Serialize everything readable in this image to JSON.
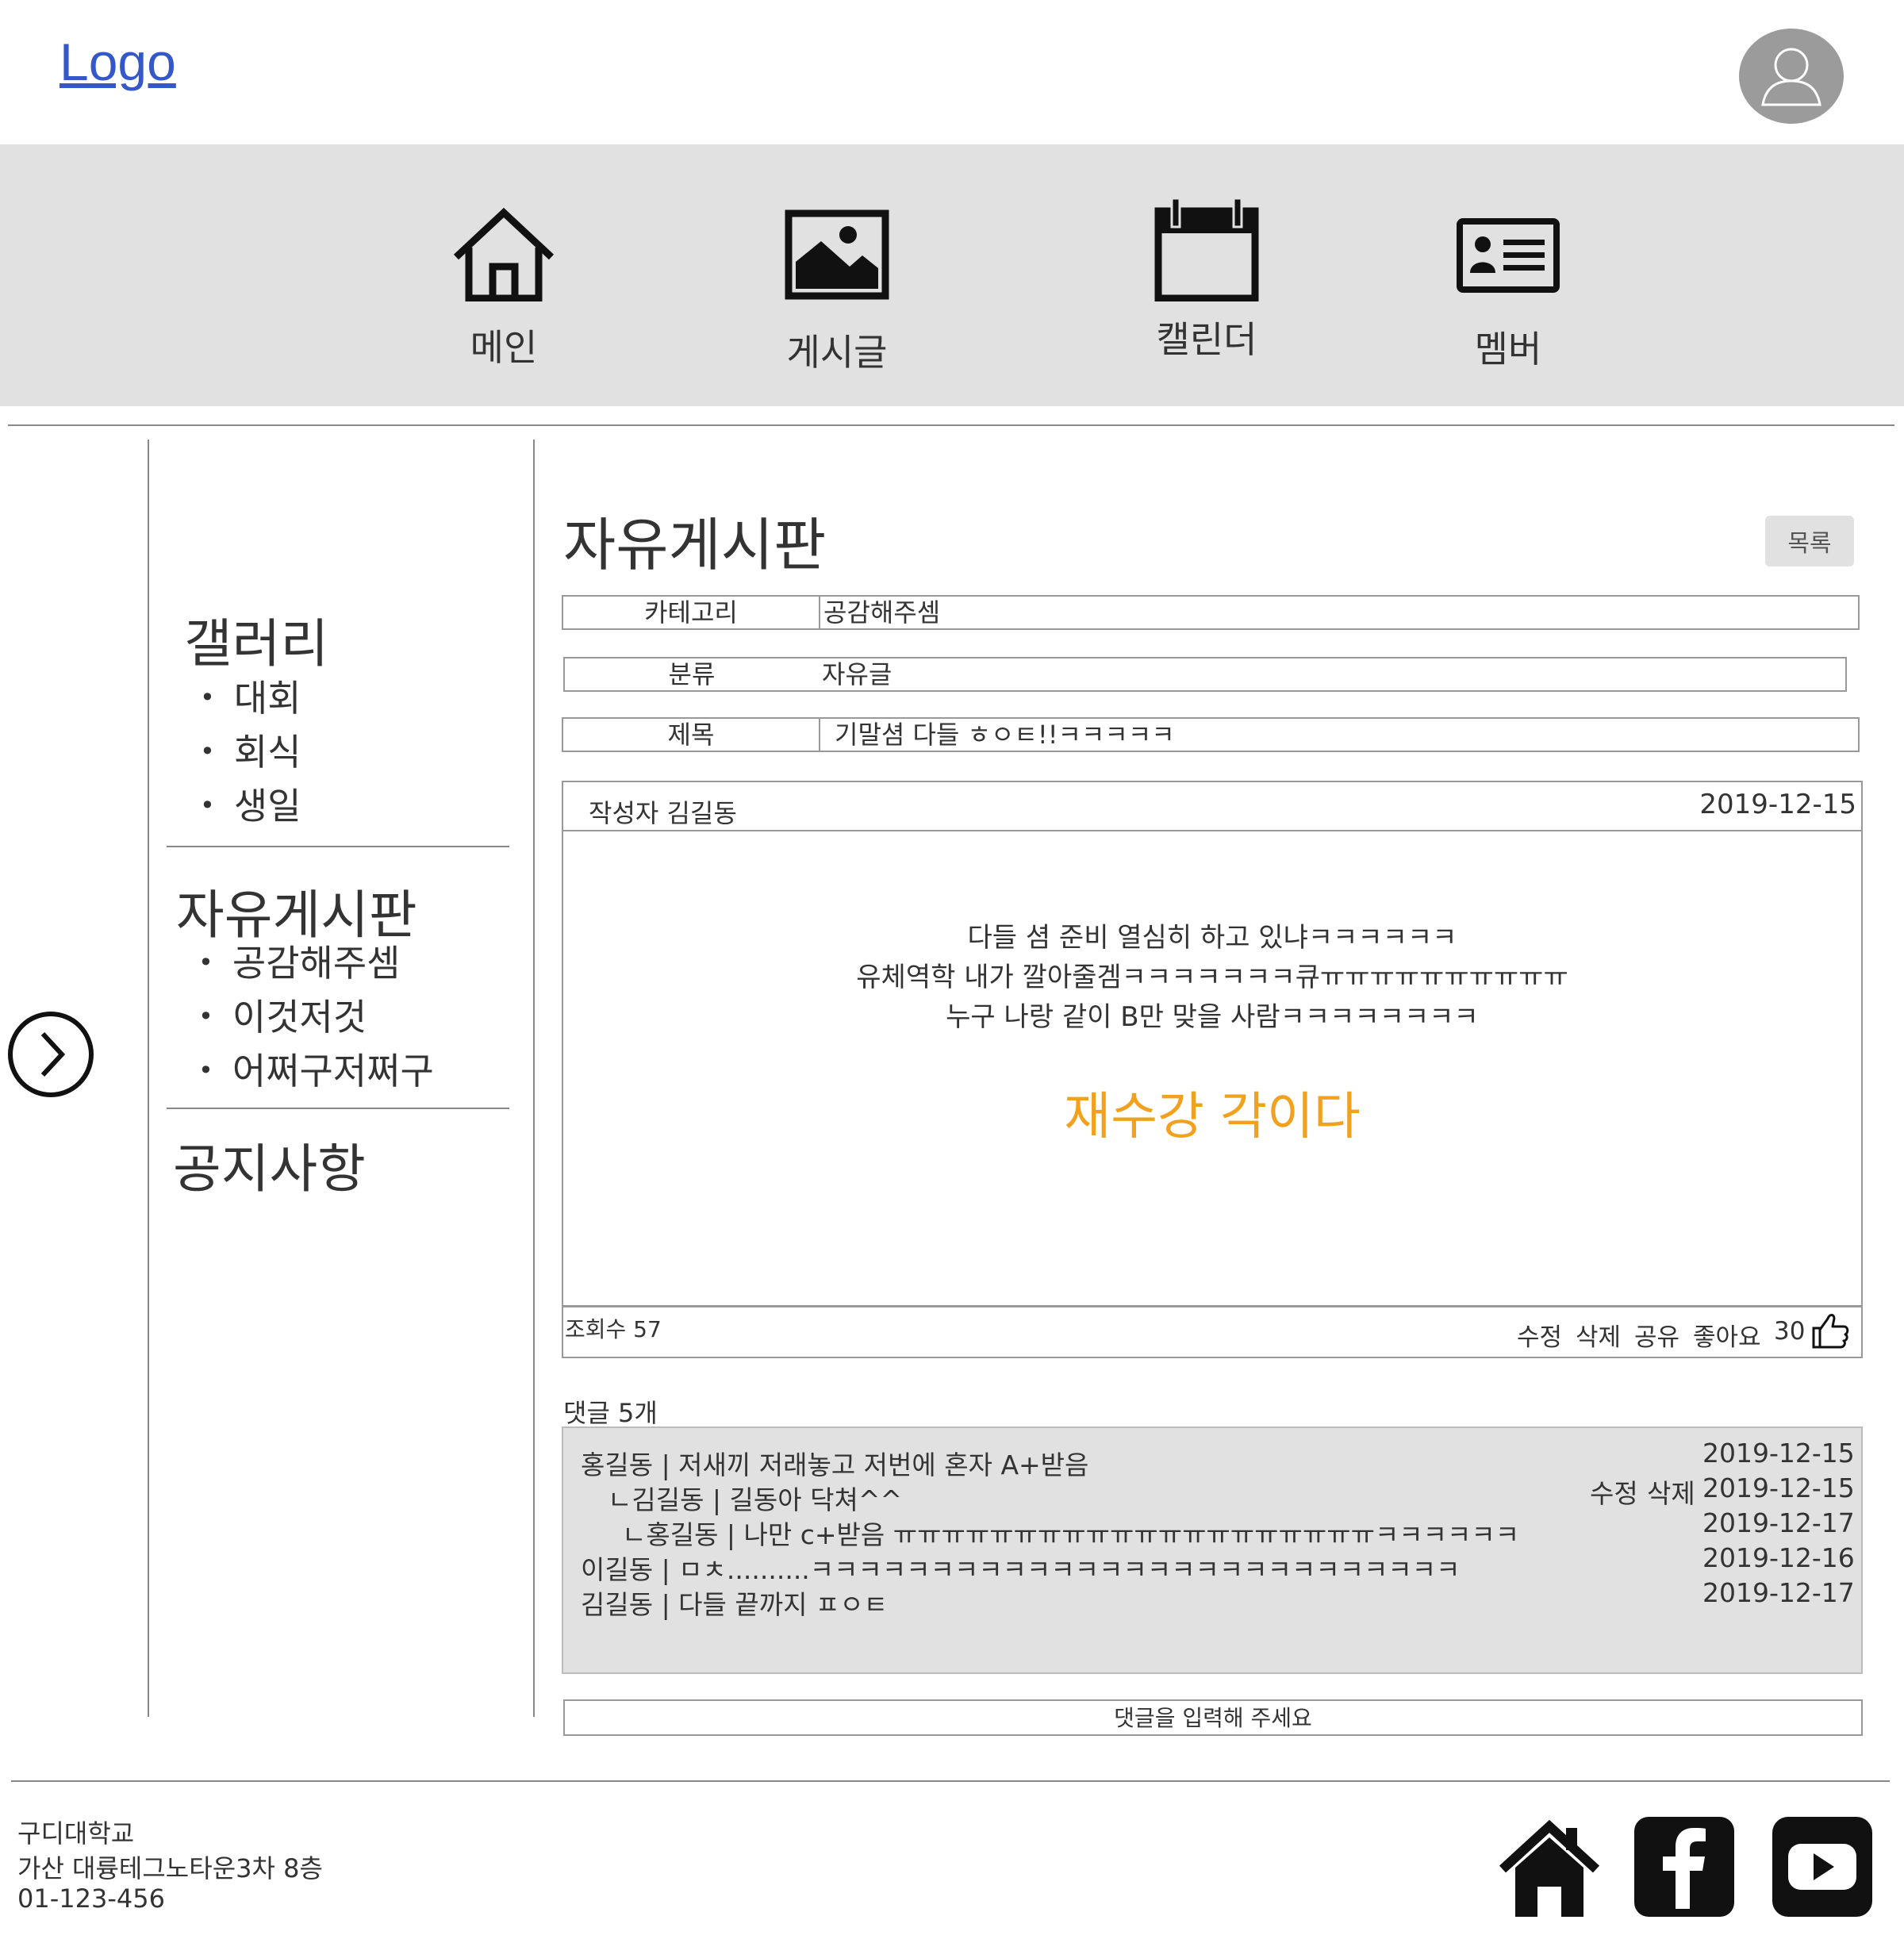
{
  "header": {
    "logo": "Logo"
  },
  "nav": {
    "items": [
      {
        "label": "메인",
        "icon": "home-icon"
      },
      {
        "label": "게시글",
        "icon": "image-icon"
      },
      {
        "label": "캘린더",
        "icon": "calendar-icon"
      },
      {
        "label": "멤버",
        "icon": "id-card-icon"
      }
    ]
  },
  "sidebar": {
    "gallery": {
      "title": "갤러리",
      "items": [
        "대회",
        "회식",
        "생일"
      ]
    },
    "board": {
      "title": "자유게시판",
      "items": [
        "공감해주셈",
        "이것저것",
        "어쩌구저쩌구"
      ]
    },
    "notice": {
      "title": "공지사항"
    }
  },
  "main": {
    "title": "자유게시판",
    "list_button": "목록",
    "fields": [
      {
        "label": "카테고리",
        "value": "공감해주셈"
      },
      {
        "label": "분류",
        "value": "자유글"
      },
      {
        "label": "제목",
        "value": "기말셤 다들 ㅎㅇㅌ!!ㅋㅋㅋㅋㅋ"
      }
    ],
    "post": {
      "author": "작성자 김길동",
      "date": "2019-12-15",
      "body_lines": [
        "다들 셤 준비 열심히 하고 있냐ㅋㅋㅋㅋㅋㅋ",
        "유체역학 내가 깔아줄겜ㅋㅋㅋㅋㅋㅋㅋ큐ㅠㅠㅠㅠㅠㅠㅠㅠㅠㅠ",
        "누구 나랑 같이 B만 맞을 사람ㅋㅋㅋㅋㅋㅋㅋㅋ"
      ],
      "highlight": "재수강 각이다",
      "views": "조회수 57",
      "actions": {
        "edit": "수정",
        "delete": "삭제",
        "share": "공유",
        "like": "좋아요",
        "like_count": "30"
      }
    },
    "comments": {
      "count_label": "댓글 5개",
      "items": [
        {
          "text": "홍길동  |   저새끼 저래놓고 저번에 혼자 A+받음",
          "date": "2019-12-15"
        },
        {
          "text": "ㄴ김길동 | 길동아 닥쳐^^",
          "date": "2019-12-15"
        },
        {
          "text": "ㄴ홍길동 | 나만 c+받음 ㅠㅠㅠㅠㅠㅠㅠㅠㅠㅠㅠㅠㅠㅠㅠㅠㅠㅠㅠㅠㅋㅋㅋㅋㅋㅋ",
          "date": "2019-12-17"
        },
        {
          "text": "이길동 | ㅁㅊ..........ㅋㅋㅋㅋㅋㅋㅋㅋㅋㅋㅋㅋㅋㅋㅋㅋㅋㅋㅋㅋㅋㅋㅋㅋㅋㅋㅋ",
          "date": "2019-12-16"
        },
        {
          "text": "김길동 | 다들 끝까지 ㅍㅇㅌ",
          "date": "2019-12-17"
        }
      ],
      "row_actions": {
        "edit": "수정",
        "delete": "삭제"
      },
      "input_placeholder": "댓글을 입력해 주세요"
    }
  },
  "footer": {
    "name": "구디대학교",
    "address": "가산 대륭테그노타운3차 8층",
    "phone": "01-123-456",
    "social": [
      "home-icon",
      "facebook-icon",
      "youtube-icon"
    ]
  }
}
